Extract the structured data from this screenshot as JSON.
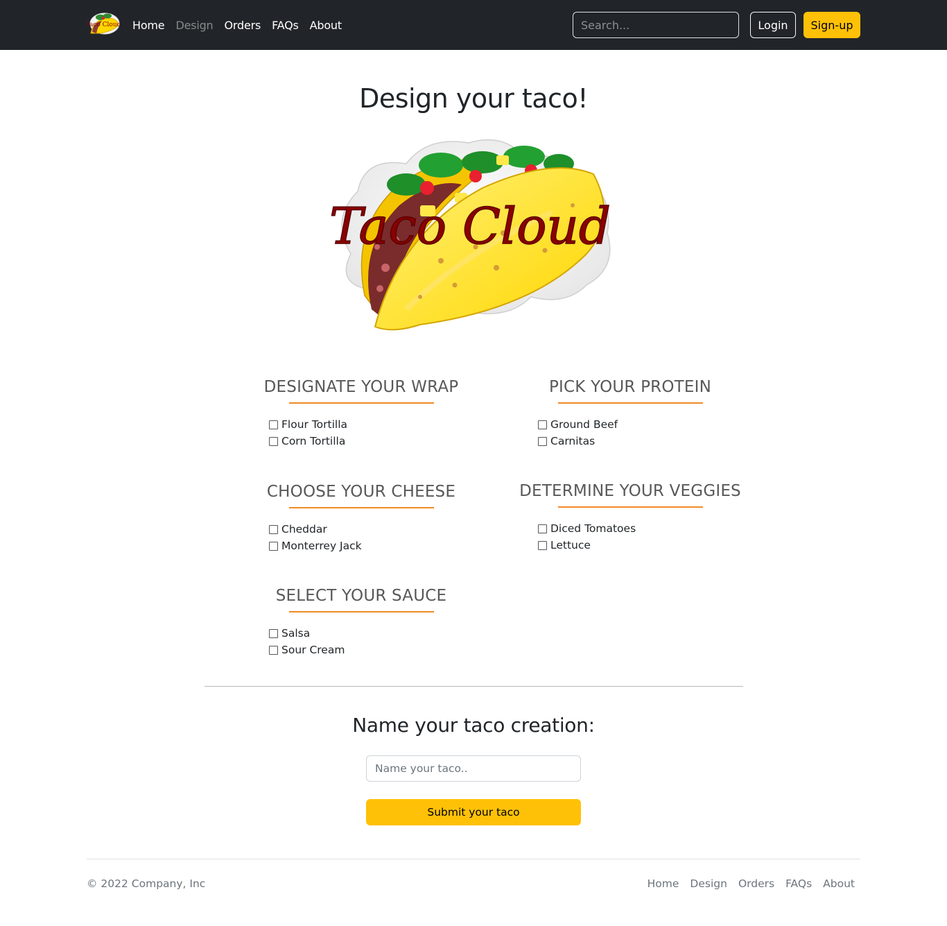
{
  "nav": {
    "logo_text": "Taco Cloud",
    "links": [
      "Home",
      "Design",
      "Orders",
      "FAQs",
      "About"
    ],
    "active": "Design",
    "search_placeholder": "Search...",
    "login_label": "Login",
    "signup_label": "Sign-up"
  },
  "page_title": "Design your taco!",
  "hero": {
    "logo_text": "Taco Cloud"
  },
  "groups": [
    {
      "title": "DESIGNATE YOUR WRAP",
      "items": [
        "Flour Tortilla",
        "Corn Tortilla"
      ]
    },
    {
      "title": "PICK YOUR PROTEIN",
      "items": [
        "Ground Beef",
        "Carnitas"
      ]
    },
    {
      "title": "CHOOSE YOUR CHEESE",
      "items": [
        "Cheddar",
        "Monterrey Jack"
      ]
    },
    {
      "title": "DETERMINE YOUR VEGGIES",
      "items": [
        "Diced Tomatoes",
        "Lettuce"
      ]
    },
    {
      "title": "SELECT YOUR SAUCE",
      "items": [
        "Salsa",
        "Sour Cream"
      ]
    }
  ],
  "name_section": {
    "title": "Name your taco creation:",
    "placeholder": "Name your taco..",
    "submit_label": "Submit your taco"
  },
  "footer": {
    "copyright": "© 2022 Company, Inc",
    "links": [
      "Home",
      "Design",
      "Orders",
      "FAQs",
      "About"
    ]
  },
  "colors": {
    "navbar_bg": "#212529",
    "accent_yellow": "#ffc107",
    "rule_orange": "#f08a24",
    "logo_red": "#8b0000"
  }
}
